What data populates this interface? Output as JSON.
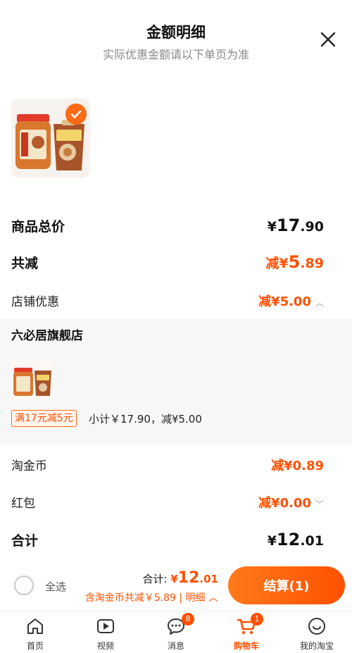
{
  "header": {
    "title": "金额明细",
    "subtitle": "实际优惠金额请以下单页为准"
  },
  "summary": {
    "goods_total_label": "商品总价",
    "goods_total_symbol": "¥",
    "goods_total_int": "17",
    "goods_total_dec": ".90",
    "reduce_label": "共减",
    "reduce_prefix": "减¥",
    "reduce_int": "5",
    "reduce_dec": ".89",
    "shop_discount_label": "店铺优惠",
    "shop_discount_value": "减¥5.00"
  },
  "shop": {
    "name": "六必居旗舰店",
    "promo_tag": "满17元减5元",
    "subtotal": "小计￥17.90，减¥5.00"
  },
  "extras": {
    "coin_label": "淘金币",
    "coin_value": "减¥0.89",
    "redpacket_label": "红包",
    "redpacket_value": "减¥0.00",
    "total_label": "合计",
    "total_symbol": "¥",
    "total_int": "12",
    "total_dec": ".01"
  },
  "bottom": {
    "select_all": "全选",
    "total_prefix": "合计:",
    "total_symbol": "¥",
    "total_int": "12",
    "total_dec": ".01",
    "coin_note": "含淘金币共减￥5.89 | 明细",
    "checkout": "结算(1)"
  },
  "tabs": [
    {
      "label": "首页",
      "icon": "home-icon"
    },
    {
      "label": "视频",
      "icon": "video-icon"
    },
    {
      "label": "消息",
      "icon": "message-icon",
      "badge": "8"
    },
    {
      "label": "购物车",
      "icon": "cart-icon",
      "badge": "1",
      "active": true
    },
    {
      "label": "我的淘宝",
      "icon": "profile-icon"
    }
  ],
  "colors": {
    "accent": "#ff5000",
    "accent_light": "#ff7a1a",
    "muted_text": "#888888",
    "panel_bg": "#f7f7f7"
  }
}
